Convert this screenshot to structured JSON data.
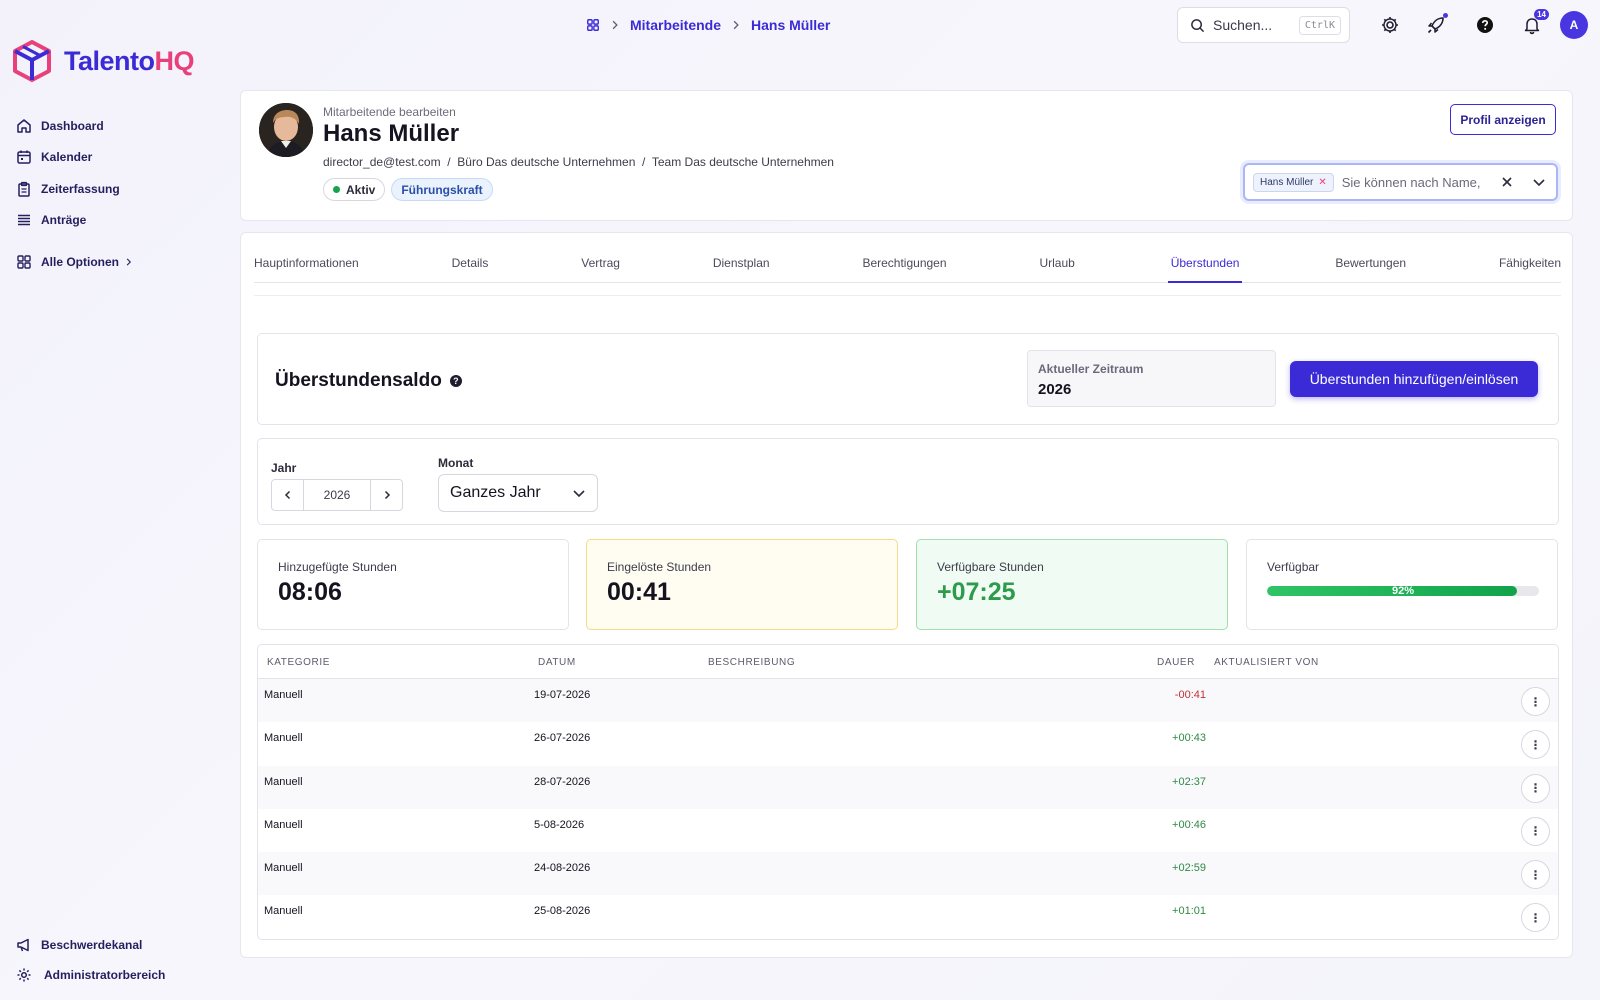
{
  "app": {
    "logo_main": "Talento",
    "logo_accent": "HQ"
  },
  "sidebar": {
    "items": [
      {
        "label": "Dashboard",
        "icon": "home-icon"
      },
      {
        "label": "Kalender",
        "icon": "calendar-icon"
      },
      {
        "label": "Zeiterfassung",
        "icon": "clipboard-icon"
      },
      {
        "label": "Anträge",
        "icon": "list-icon"
      }
    ],
    "all_options": "Alle Optionen",
    "bottom": [
      {
        "label": "Beschwerdekanal",
        "icon": "megaphone-icon"
      },
      {
        "label": "Administratorbereich",
        "icon": "gear-icon"
      }
    ]
  },
  "topbar": {
    "breadcrumb": [
      "Mitarbeitende",
      "Hans Müller"
    ],
    "search_placeholder": "Suchen...",
    "search_shortcut": "CtrlK",
    "notification_count": "14",
    "avatar_initial": "A"
  },
  "profile": {
    "subtitle": "Mitarbeitende bearbeiten",
    "name": "Hans Müller",
    "email": "director_de@test.com",
    "office": "Büro Das deutsche Unternehmen",
    "team": "Team Das deutsche Unternehmen",
    "status": "Aktiv",
    "role": "Führungskraft",
    "view_profile": "Profil anzeigen",
    "employee_chip": "Hans Müller",
    "employee_placeholder": "Sie können nach Name,"
  },
  "tabs": [
    "Hauptinformationen",
    "Details",
    "Vertrag",
    "Dienstplan",
    "Berechtigungen",
    "Urlaub",
    "Überstunden",
    "Bewertungen",
    "Fähigkeiten"
  ],
  "active_tab": "Überstunden",
  "overtime": {
    "title": "Überstundensaldo",
    "period_label": "Aktueller Zeitraum",
    "period_value": "2026",
    "add_button": "Überstunden hinzufügen/einlösen",
    "year_label": "Jahr",
    "year_value": "2026",
    "month_label": "Monat",
    "month_value": "Ganzes Jahr"
  },
  "stats": {
    "added_label": "Hinzugefügte Stunden",
    "added_value": "08:06",
    "redeemed_label": "Eingelöste Stunden",
    "redeemed_value": "00:41",
    "available_label": "Verfügbare Stunden",
    "available_value": "+07:25",
    "avail_pct_label": "Verfügbar",
    "avail_pct_text": "92%",
    "avail_pct": 92
  },
  "table": {
    "headers": {
      "category": "KATEGORIE",
      "date": "DATUM",
      "description": "BESCHREIBUNG",
      "duration": "DAUER",
      "updated_by": "AKTUALISIERT VON"
    },
    "rows": [
      {
        "category": "Manuell",
        "date": "19-07-2026",
        "duration": "-00:41",
        "sign": "neg"
      },
      {
        "category": "Manuell",
        "date": "26-07-2026",
        "duration": "+00:43",
        "sign": "pos"
      },
      {
        "category": "Manuell",
        "date": "28-07-2026",
        "duration": "+02:37",
        "sign": "pos"
      },
      {
        "category": "Manuell",
        "date": "5-08-2026",
        "duration": "+00:46",
        "sign": "pos"
      },
      {
        "category": "Manuell",
        "date": "24-08-2026",
        "duration": "+02:59",
        "sign": "pos"
      },
      {
        "category": "Manuell",
        "date": "25-08-2026",
        "duration": "+01:01",
        "sign": "pos"
      }
    ]
  },
  "colors": {
    "brand": "#3b2bd6",
    "accent": "#e8407a",
    "positive": "#2e8a45",
    "negative": "#c2313a"
  }
}
